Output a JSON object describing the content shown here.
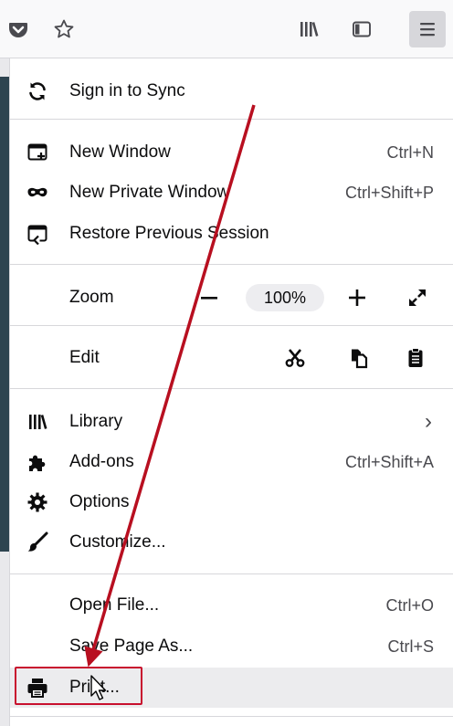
{
  "menu": {
    "sync": {
      "label": "Sign in to Sync"
    },
    "new_window": {
      "label": "New Window",
      "shortcut": "Ctrl+N"
    },
    "new_private": {
      "label": "New Private Window",
      "shortcut": "Ctrl+Shift+P"
    },
    "restore": {
      "label": "Restore Previous Session"
    },
    "zoom": {
      "label": "Zoom",
      "value": "100%"
    },
    "edit": {
      "label": "Edit"
    },
    "library": {
      "label": "Library",
      "chevron": "›"
    },
    "addons": {
      "label": "Add-ons",
      "shortcut": "Ctrl+Shift+A"
    },
    "options": {
      "label": "Options"
    },
    "customize": {
      "label": "Customize..."
    },
    "open_file": {
      "label": "Open File...",
      "shortcut": "Ctrl+O"
    },
    "save_page": {
      "label": "Save Page As...",
      "shortcut": "Ctrl+S"
    },
    "print": {
      "label": "Print..."
    }
  },
  "colors": {
    "annotation_red": "#c8102e",
    "hover_bg": "#ececee",
    "toolbar_bg": "#f9f9fa"
  },
  "icons": {
    "toolbar": [
      "pocket-icon",
      "bookmark-star-icon",
      "library-icon",
      "sidebar-icon",
      "hamburger-menu-icon"
    ],
    "menu": [
      "sync-icon",
      "new-window-icon",
      "private-mask-icon",
      "restore-session-icon",
      "zoom-out-icon",
      "zoom-in-icon",
      "fullscreen-icon",
      "cut-icon",
      "copy-icon",
      "paste-icon",
      "library-icon",
      "addons-puzzle-icon",
      "options-gear-icon",
      "customize-brush-icon",
      "printer-icon"
    ]
  }
}
